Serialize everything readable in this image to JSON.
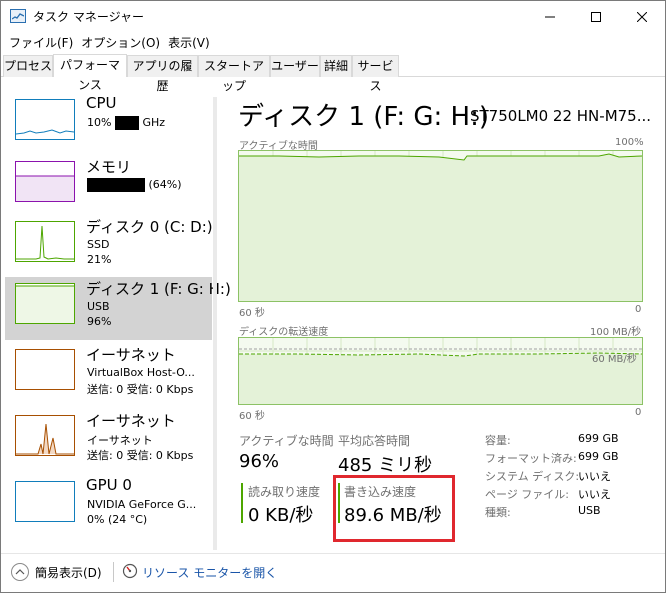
{
  "window": {
    "title": "タスク マネージャー",
    "min_label": "–",
    "max_label": "□",
    "close_label": "✕"
  },
  "menu": [
    "ファイル(F)",
    "オプション(O)",
    "表示(V)"
  ],
  "tabs": [
    "プロセス",
    "パフォーマンス",
    "アプリの履歴",
    "スタートアップ",
    "ユーザー",
    "詳細",
    "サービス"
  ],
  "active_tab": "パフォーマンス",
  "sidebar": {
    "items": [
      {
        "title": "CPU",
        "line1_prefix": "10%",
        "line1_suffix": "GHz",
        "line2": ""
      },
      {
        "title": "メモリ",
        "line1_prefix": "",
        "line1_suffix": "(64%)",
        "line2": ""
      },
      {
        "title": "ディスク 0 (C: D:)",
        "line1": "SSD",
        "line2": "21%"
      },
      {
        "title": "ディスク 1 (F: G: H:)",
        "line1": "USB",
        "line2": "96%"
      },
      {
        "title": "イーサネット",
        "line1": "VirtualBox Host-O...",
        "line2": "送信: 0 受信: 0 Kbps"
      },
      {
        "title": "イーサネット",
        "line1": "イーサネット",
        "line2": "送信: 0 受信: 0 Kbps"
      },
      {
        "title": "GPU 0",
        "line1": "NVIDIA GeForce G...",
        "line2": "0% (24 °C)"
      }
    ]
  },
  "detail": {
    "heading": "ディスク 1 (F: G: H:)",
    "model": "ST750LM0 22 HN-M75...",
    "graph1": {
      "label_left": "アクティブな時間",
      "label_right": "100%",
      "time_left": "60 秒",
      "time_right": "0"
    },
    "graph2": {
      "label_left": "ディスクの転送速度",
      "label_right": "100 MB/秒",
      "inner_label": "60 MB/秒",
      "time_left": "60 秒",
      "time_right": "0"
    },
    "stats": {
      "active_time_label": "アクティブな時間",
      "active_time_value": "96%",
      "avg_response_label": "平均応答時間",
      "avg_response_value": "485 ミリ秒",
      "read_speed_label": "読み取り速度",
      "read_speed_value": "0 KB/秒",
      "write_speed_label": "書き込み速度",
      "write_speed_value": "89.6 MB/秒"
    },
    "properties": [
      {
        "key": "容量:",
        "value": "699 GB"
      },
      {
        "key": "フォーマット済み:",
        "value": "699 GB"
      },
      {
        "key": "システム ディスク:",
        "value": "いいえ"
      },
      {
        "key": "ページ ファイル:",
        "value": "いいえ"
      },
      {
        "key": "種類:",
        "value": "USB"
      }
    ]
  },
  "footer": {
    "collapse_label": "簡易表示(D)",
    "resource_monitor_link": "リソース モニターを開く"
  },
  "colors": {
    "cpu": "#117dbb",
    "memory": "#8b12ae",
    "disk": "#4da600",
    "ethernet": "#a74f01",
    "highlight": "#e0282e"
  }
}
